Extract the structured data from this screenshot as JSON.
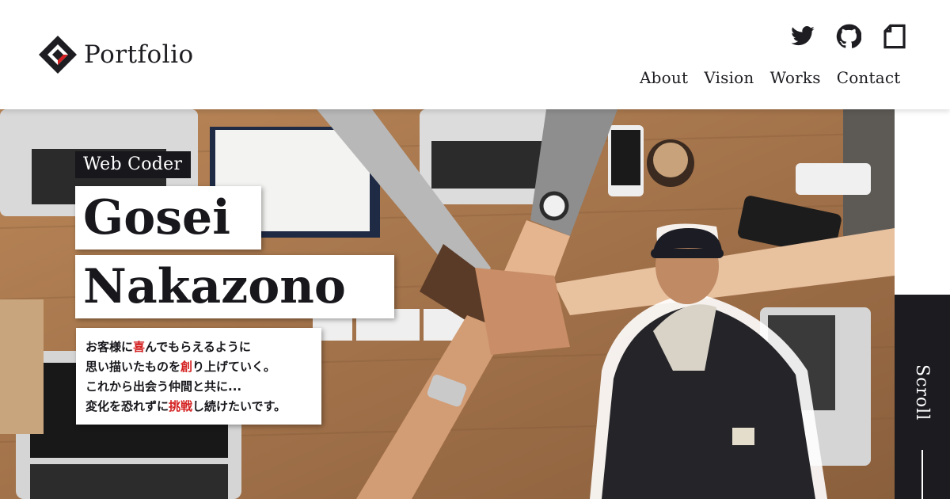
{
  "header": {
    "logo_text": "Portfolio",
    "social": [
      {
        "icon": "twitter-icon"
      },
      {
        "icon": "github-icon"
      },
      {
        "icon": "document-icon"
      }
    ],
    "nav": [
      {
        "label": "About"
      },
      {
        "label": "Vision"
      },
      {
        "label": "Works"
      },
      {
        "label": "Contact"
      }
    ]
  },
  "hero": {
    "role_tag": "Web Coder",
    "first_name": "Gosei",
    "last_name": "Nakazono",
    "intro": {
      "line1_a": "お客様に",
      "line1_hl": "喜",
      "line1_b": "んでもらえるように",
      "line2_a": "思い描いたものを",
      "line2_hl": "創",
      "line2_b": "り上げていく。",
      "line3": "これから出会う仲間と共に...",
      "line4_a": "変化を恐れずに",
      "line4_hl": "挑戦",
      "line4_b": "し続けたいです。"
    }
  },
  "scroll_label": "Scroll",
  "colors": {
    "dark": "#1b1b20",
    "highlight": "#d42020",
    "logo_accent": "#d42020"
  }
}
